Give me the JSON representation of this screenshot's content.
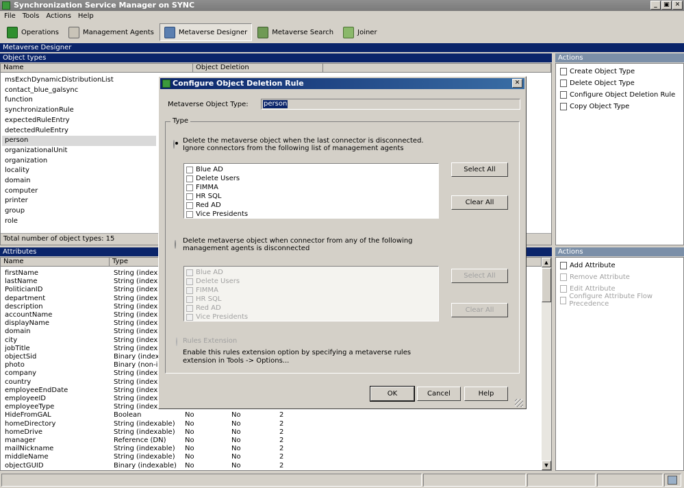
{
  "window": {
    "title": "Synchronization Service Manager on SYNC",
    "minimize": "_",
    "maximize": "▣",
    "close": "✕"
  },
  "menu": [
    "File",
    "Tools",
    "Actions",
    "Help"
  ],
  "toolbar": {
    "operations": "Operations",
    "management_agents": "Management Agents",
    "metaverse_designer": "Metaverse Designer",
    "metaverse_search": "Metaverse Search",
    "joiner": "Joiner"
  },
  "designer_title": "Metaverse Designer",
  "object_types": {
    "header": "Object types",
    "col_name": "Name",
    "col_deletion": "Object Deletion",
    "rows": [
      "msExchDynamicDistributionList",
      "contact_blue_galsync",
      "function",
      "synchronizationRule",
      "expectedRuleEntry",
      "detectedRuleEntry",
      "person",
      "organizationalUnit",
      "organization",
      "locality",
      "domain",
      "computer",
      "printer",
      "group",
      "role"
    ],
    "selected": "person",
    "total": "Total number of object types: 15"
  },
  "actions_top": {
    "header": "Actions",
    "items": [
      "Create Object Type",
      "Delete Object Type",
      "Configure Object Deletion Rule",
      "Copy Object Type"
    ]
  },
  "attributes": {
    "header": "Attributes",
    "col_name": "Name",
    "col_type": "Type",
    "rows": [
      {
        "name": "firstName",
        "type": "String (indexable"
      },
      {
        "name": "lastName",
        "type": "String (indexable"
      },
      {
        "name": "PoliticianID",
        "type": "String (indexable"
      },
      {
        "name": "department",
        "type": "String (indexable"
      },
      {
        "name": "description",
        "type": "String (indexable"
      },
      {
        "name": "accountName",
        "type": "String (indexable"
      },
      {
        "name": "displayName",
        "type": "String (indexable"
      },
      {
        "name": "domain",
        "type": "String (indexable"
      },
      {
        "name": "city",
        "type": "String (indexable"
      },
      {
        "name": "jobTitle",
        "type": "String (indexable"
      },
      {
        "name": "objectSid",
        "type": "Binary (indexable"
      },
      {
        "name": "photo",
        "type": "Binary (non-index"
      },
      {
        "name": "company",
        "type": "String (indexable"
      },
      {
        "name": "country",
        "type": "String (indexable"
      },
      {
        "name": "employeeEndDate",
        "type": "String (indexable"
      },
      {
        "name": "employeeID",
        "type": "String (indexable"
      },
      {
        "name": "employeeType",
        "type": "String (indexable"
      },
      {
        "name": "HideFromGAL",
        "type": "Boolean",
        "c3": "No",
        "c4": "No",
        "c5": "2"
      },
      {
        "name": "homeDirectory",
        "type": "String (indexable)",
        "c3": "No",
        "c4": "No",
        "c5": "2"
      },
      {
        "name": "homeDrive",
        "type": "String (indexable)",
        "c3": "No",
        "c4": "No",
        "c5": "2"
      },
      {
        "name": "manager",
        "type": "Reference (DN)",
        "c3": "No",
        "c4": "No",
        "c5": "2"
      },
      {
        "name": "mailNickname",
        "type": "String (indexable)",
        "c3": "No",
        "c4": "No",
        "c5": "2"
      },
      {
        "name": "middleName",
        "type": "String (indexable)",
        "c3": "No",
        "c4": "No",
        "c5": "2"
      },
      {
        "name": "objectGUID",
        "type": "Binary (indexable)",
        "c3": "No",
        "c4": "No",
        "c5": "2"
      }
    ]
  },
  "actions_bottom": {
    "header": "Actions",
    "items": [
      {
        "label": "Add Attribute",
        "enabled": true
      },
      {
        "label": "Remove Attribute",
        "enabled": false
      },
      {
        "label": "Edit Attribute",
        "enabled": false
      },
      {
        "label": "Configure Attribute Flow Precedence",
        "enabled": false
      }
    ]
  },
  "dialog": {
    "title": "Configure Object Deletion Rule",
    "close": "✕",
    "mv_type_label": "Metaverse Object Type:",
    "mv_type_value": "person",
    "type_group": "Type",
    "option1": "Delete the metaverse object when the last connector is disconnected. Ignore connectors from the following list of management agents",
    "option2": "Delete metaverse object when connector from any of the following management agents is disconnected",
    "option3": "Rules Extension",
    "rules_note": "Enable this rules extension option by specifying a metaverse rules extension in Tools -> Options...",
    "agents": [
      "Blue AD",
      "Delete Users",
      "FIMMA",
      "HR SQL",
      "Red AD",
      "Vice Presidents"
    ],
    "select_all": "Select All",
    "clear_all": "Clear All",
    "ok": "OK",
    "cancel": "Cancel",
    "help": "Help"
  }
}
